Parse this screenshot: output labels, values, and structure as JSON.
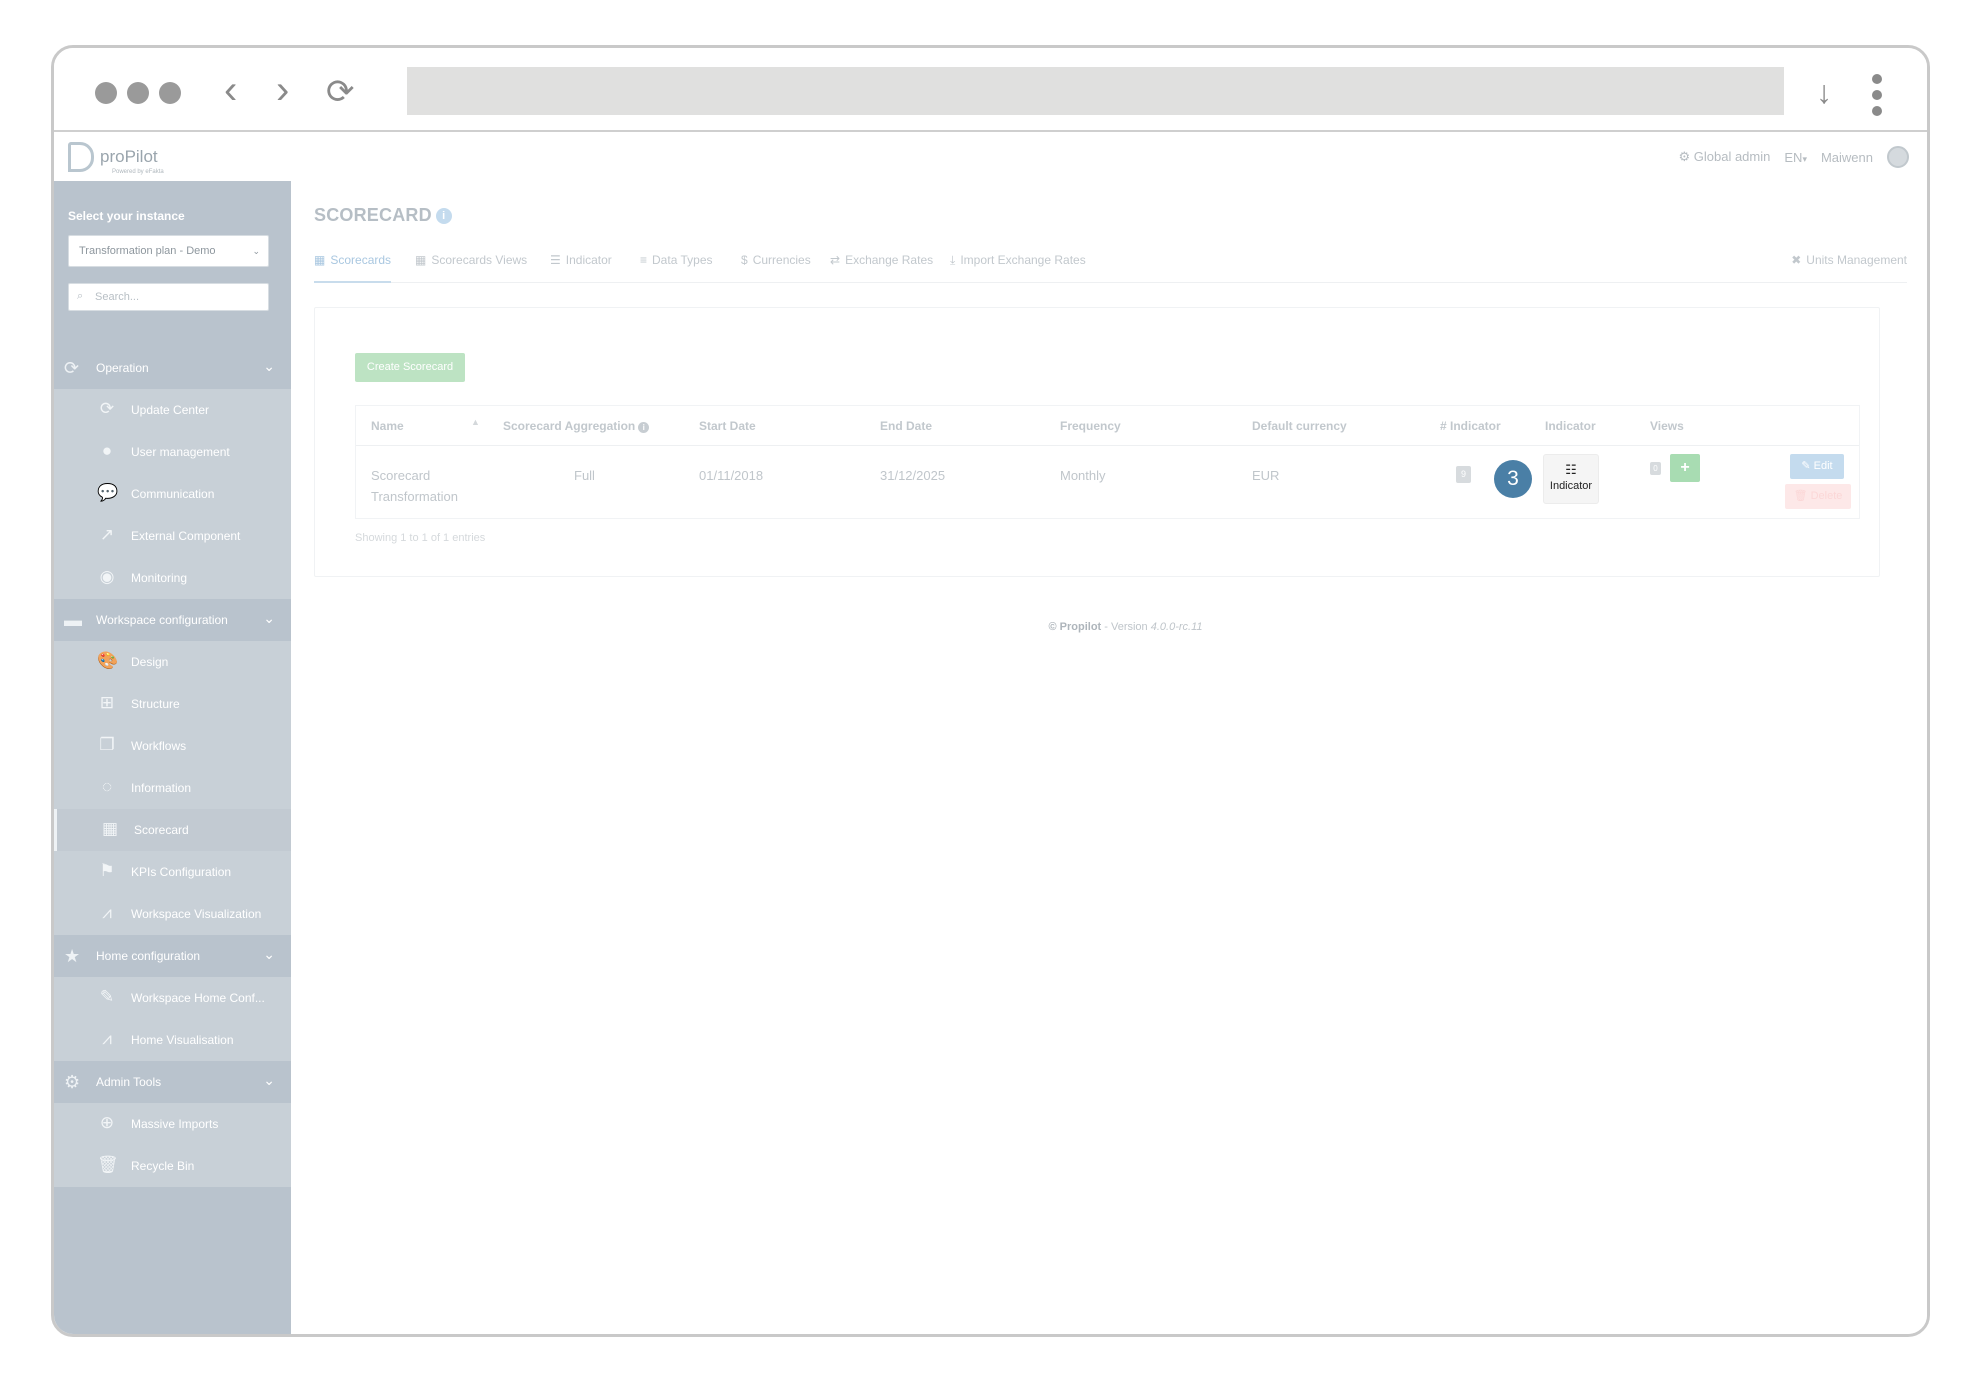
{
  "app": {
    "logo_text": "proPilot",
    "logo_sub": "Powered by eFakta"
  },
  "topbar": {
    "global_admin": "Global admin",
    "language": "EN",
    "user": "Maiwenn"
  },
  "sidebar": {
    "instance_label": "Select your instance",
    "instance_value": "Transformation plan - Demo",
    "search_placeholder": "Search...",
    "sections": [
      {
        "label": "Operation",
        "icon": "refresh-icon"
      },
      {
        "label": "Workspace configuration",
        "icon": "folder-icon"
      },
      {
        "label": "Home configuration",
        "icon": "star-icon"
      },
      {
        "label": "Admin Tools",
        "icon": "gear-icon"
      }
    ],
    "items": [
      {
        "label": "Update Center",
        "icon": "refresh-icon"
      },
      {
        "label": "User management",
        "icon": "user-icon"
      },
      {
        "label": "Communication",
        "icon": "chat-icon"
      },
      {
        "label": "External Component",
        "icon": "external-link-icon"
      },
      {
        "label": "Monitoring",
        "icon": "eye-icon"
      },
      {
        "label": "Design",
        "icon": "palette-icon"
      },
      {
        "label": "Structure",
        "icon": "sitemap-icon"
      },
      {
        "label": "Workflows",
        "icon": "copy-icon"
      },
      {
        "label": "Information",
        "icon": "comment-icon"
      },
      {
        "label": "Scorecard",
        "icon": "table-icon"
      },
      {
        "label": "KPIs Configuration",
        "icon": "flag-icon"
      },
      {
        "label": "Workspace Visualization",
        "icon": "chart-icon"
      },
      {
        "label": "Workspace Home Conf...",
        "icon": "edit-icon"
      },
      {
        "label": "Home Visualisation",
        "icon": "chart-icon"
      },
      {
        "label": "Massive Imports",
        "icon": "download-icon"
      },
      {
        "label": "Recycle Bin",
        "icon": "trash-icon"
      }
    ]
  },
  "main": {
    "title": "SCORECARD",
    "tabs": [
      {
        "label": "Scorecards",
        "icon": "table-icon"
      },
      {
        "label": "Scorecards Views",
        "icon": "table-icon"
      },
      {
        "label": "Indicator",
        "icon": "list-icon"
      },
      {
        "label": "Data Types",
        "icon": "lines-icon"
      },
      {
        "label": "Currencies",
        "icon": "dollar-icon"
      },
      {
        "label": "Exchange Rates",
        "icon": "exchange-icon"
      },
      {
        "label": "Import Exchange Rates",
        "icon": "upload-icon"
      },
      {
        "label": "Units Management",
        "icon": "tools-icon"
      }
    ],
    "create_button": "Create Scorecard",
    "table": {
      "headers": [
        "Name",
        "Scorecard Aggregation",
        "Start Date",
        "End Date",
        "Frequency",
        "Default currency",
        "# Indicator",
        "Indicator",
        "Views"
      ],
      "rows": [
        {
          "name_line1": "Scorecard",
          "name_line2": "Transformation",
          "aggregation": "Full",
          "start_date": "01/11/2018",
          "end_date": "31/12/2025",
          "frequency": "Monthly",
          "currency": "EUR",
          "indicator_count": "9",
          "indicator_button": "Indicator",
          "views_count": "0",
          "edit": "Edit",
          "delete": "Delete"
        }
      ]
    },
    "step_number": "3",
    "showing": "Showing 1 to 1 of 1 entries",
    "footer_brand": "© Propilot",
    "footer_sep": " - Version ",
    "footer_version": "4.0.0-rc.11"
  }
}
